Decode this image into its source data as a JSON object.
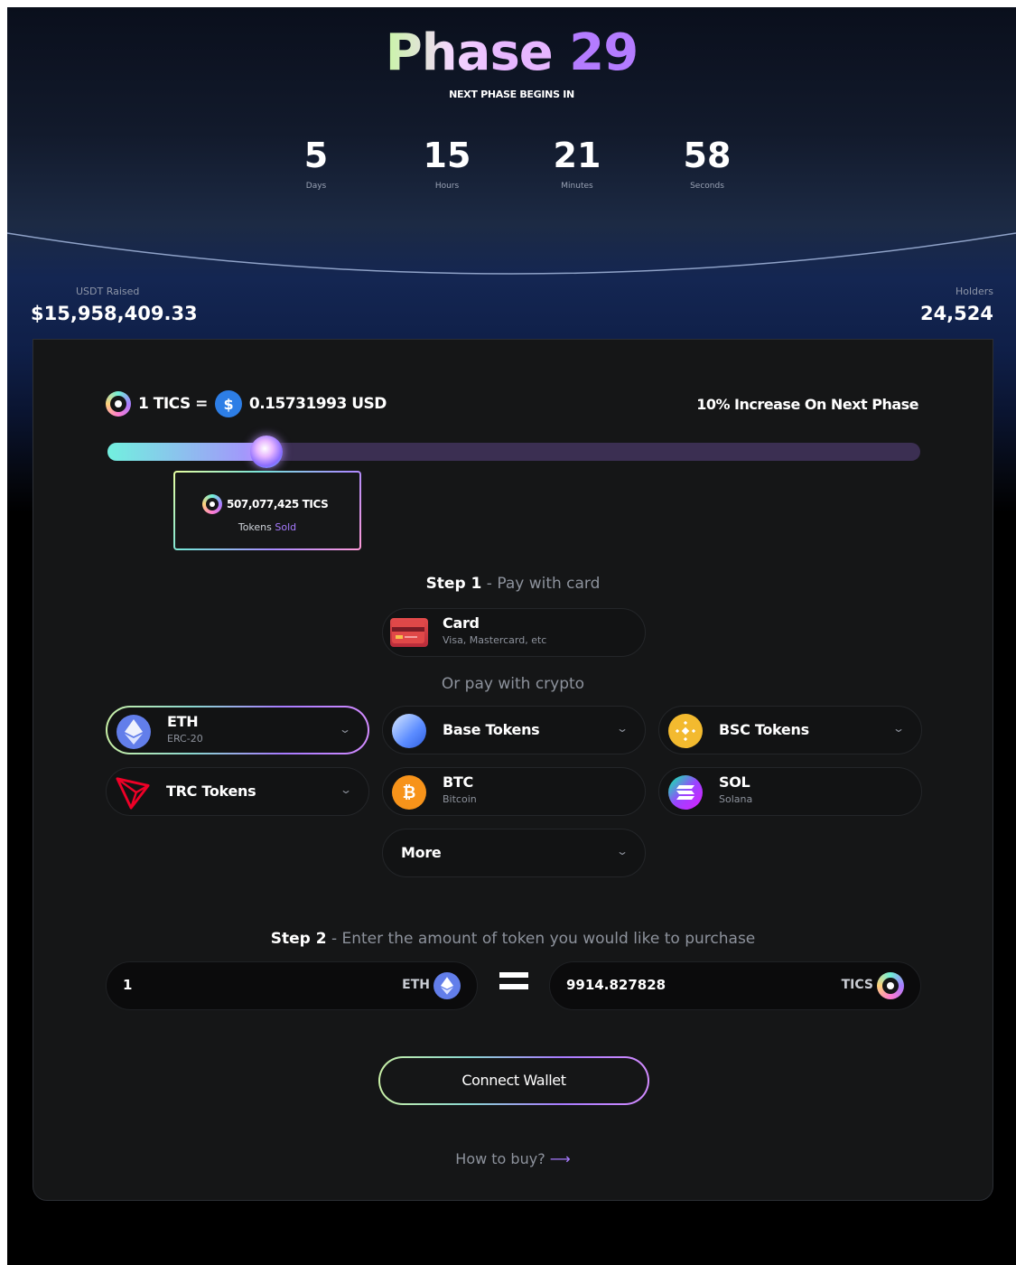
{
  "header": {
    "title_word": "Phase",
    "title_number": "29",
    "next_label": "NEXT PHASE BEGINS IN"
  },
  "countdown": [
    {
      "value": "5",
      "label": "Days"
    },
    {
      "value": "15",
      "label": "Hours"
    },
    {
      "value": "21",
      "label": "Minutes"
    },
    {
      "value": "58",
      "label": "Seconds"
    }
  ],
  "stats": {
    "raised_label": "USDT Raised",
    "raised_value": "$15,958,409.33",
    "holders_label": "Holders",
    "holders_value": "24,524"
  },
  "rate": {
    "left": "1 TICS =",
    "usd_symbol": "$",
    "right": "0.15731993 USD",
    "increase_text": "10% Increase On Next Phase"
  },
  "progress": {
    "fraction": 0.195,
    "sold_amount": "507,077,425 TICS",
    "sold_label_prefix": "Tokens",
    "sold_label_accent": "Sold"
  },
  "step1": {
    "step": "Step 1",
    "text": " - Pay with card",
    "card_name": "Card",
    "card_sub": "Visa, Mastercard, etc",
    "or_crypto": "Or pay with crypto"
  },
  "crypto_options": [
    {
      "name": "ETH",
      "sub": "ERC-20",
      "icon": "ethereum-icon",
      "color": "#627eea",
      "active": true
    },
    {
      "name": "Base Tokens",
      "sub": "",
      "icon": "base-icon",
      "color": "#5b8cff",
      "active": false
    },
    {
      "name": "BSC Tokens",
      "sub": "",
      "icon": "bnb-icon",
      "color": "#f3ba2f",
      "active": false
    },
    {
      "name": "TRC Tokens",
      "sub": "",
      "icon": "tron-icon",
      "color": "#ef0027",
      "active": false
    },
    {
      "name": "BTC",
      "sub": "Bitcoin",
      "icon": "bitcoin-icon",
      "color": "#f7931a",
      "active": false
    },
    {
      "name": "SOL",
      "sub": "Solana",
      "icon": "solana-icon",
      "color": "#9945ff",
      "active": false
    }
  ],
  "more_label": "More",
  "step2": {
    "step": "Step 2",
    "text": " - Enter the amount of token you would like to purchase",
    "pay_amount": "1",
    "pay_unit": "ETH",
    "receive_amount": "9914.827828",
    "receive_unit": "TICS"
  },
  "connect_label": "Connect Wallet",
  "how_to_buy": "How to buy?",
  "how_arrow": "⟶",
  "colors": {
    "accent": "#a77bff",
    "teal": "#72f0df",
    "eth_blue": "#627eea"
  }
}
